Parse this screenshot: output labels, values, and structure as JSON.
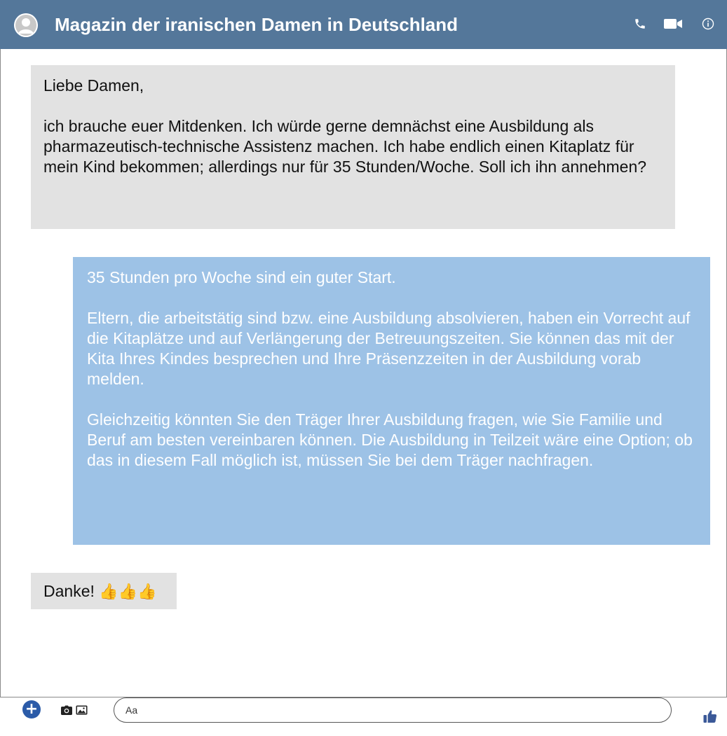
{
  "header": {
    "title": "Magazin der iranischen Damen in Deutschland",
    "bg_color": "#54779a",
    "icons": [
      "avatar-icon",
      "phone-icon",
      "video-camera-icon",
      "info-icon"
    ]
  },
  "messages": [
    {
      "direction": "incoming",
      "color": "#e2e2e2",
      "paragraphs": [
        "Liebe Damen,",
        "ich brauche euer Mitdenken. Ich würde gerne demnächst eine Ausbildung als pharmazeutisch-technische Assistenz machen. Ich habe endlich einen Kitaplatz für mein Kind bekommen; allerdings nur für 35 Stunden/Woche. Soll ich ihn annehmen?"
      ]
    },
    {
      "direction": "outgoing",
      "color": "#9dc2e6",
      "paragraphs": [
        "35 Stunden pro Woche sind ein guter Start.",
        "Eltern, die arbeitstätig sind bzw. eine Ausbildung absolvieren, haben ein Vorrecht auf die Kitaplätze und auf Verlängerung der Betreuungszeiten. Sie können das mit der Kita Ihres Kindes besprechen und Ihre Präsenzzeiten in der Ausbildung vorab melden.",
        "Gleichzeitig könnten Sie den Träger Ihrer Ausbildung fragen, wie Sie Familie und Beruf am besten vereinbaren können. Die Ausbildung in Teilzeit wäre eine Option; ob das in diesem Fall möglich ist, müssen Sie bei dem Träger nachfragen."
      ]
    },
    {
      "direction": "incoming",
      "color": "#e2e2e2",
      "text": "Danke!",
      "emoji": "👍👍👍"
    }
  ],
  "composer": {
    "placeholder": "Aa",
    "icons": [
      "plus-icon",
      "camera-icon",
      "image-icon",
      "thumbs-up-icon"
    ]
  }
}
